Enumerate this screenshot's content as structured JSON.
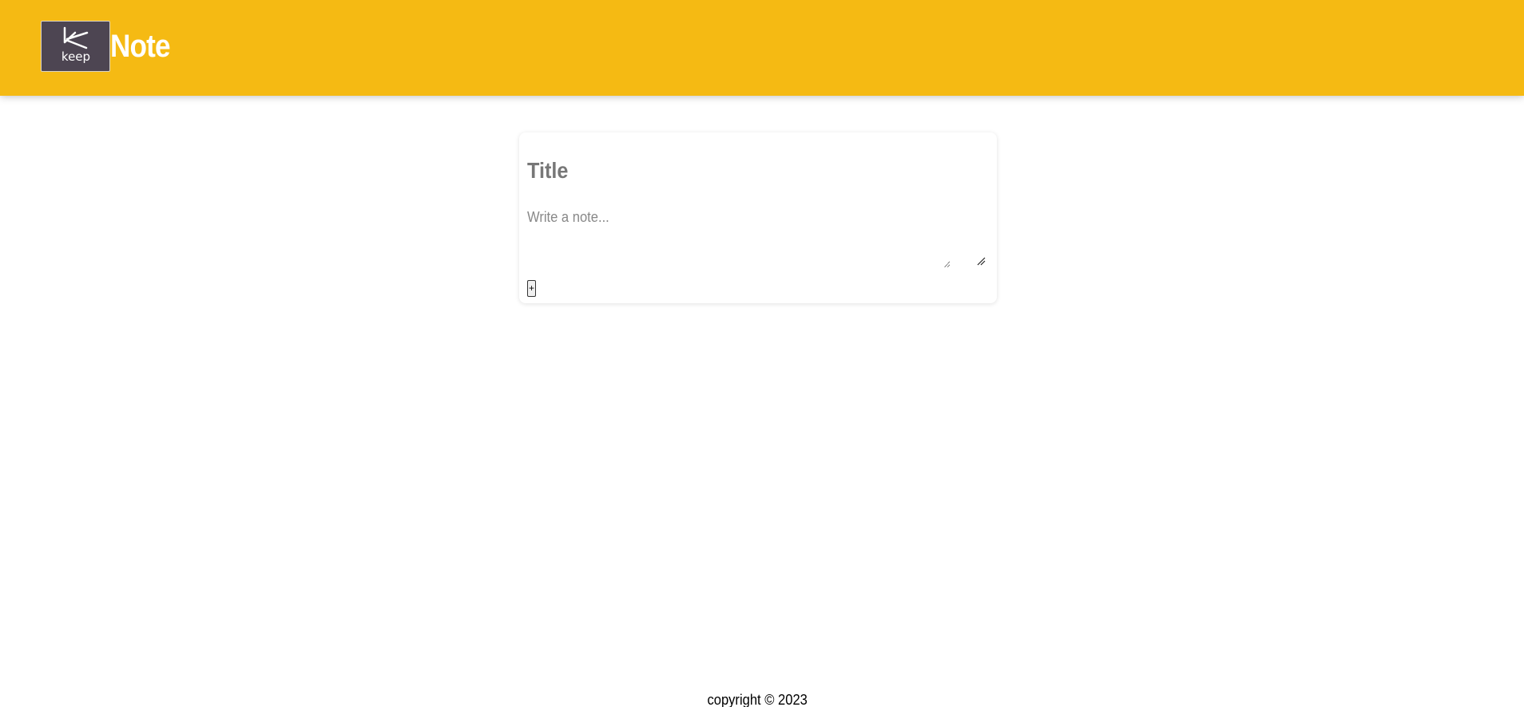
{
  "header": {
    "logo_text": "keep",
    "title": "Note"
  },
  "note_form": {
    "title_placeholder": "Title",
    "content_placeholder": "Write a note...",
    "add_label": "+"
  },
  "footer": {
    "copyright": "copyright © 2023"
  },
  "colors": {
    "header_bg": "#f5ba13",
    "logo_bg": "#4d4552"
  },
  "icons": {
    "logo": "keep-logo-icon",
    "resize": "textarea-resize-grip-icon"
  }
}
